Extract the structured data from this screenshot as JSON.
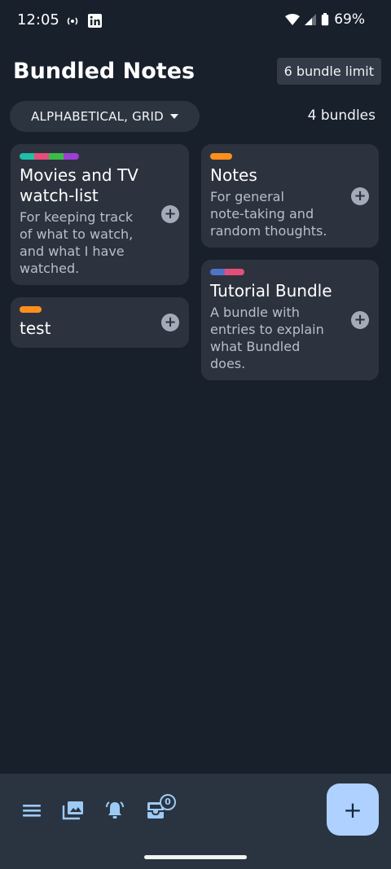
{
  "status": {
    "time": "12:05",
    "battery": "69%"
  },
  "header": {
    "title": "Bundled Notes",
    "limit_label": "6 bundle limit"
  },
  "toolbar": {
    "sort_label": "ALPHABETICAL, GRID",
    "count_label": "4 bundles"
  },
  "bundles": [
    {
      "title_line1": "Movies and TV",
      "title_line2": "watch-list",
      "desc": [
        "For keeping track",
        "of what to watch,",
        "and what I have",
        "watched."
      ],
      "colors": [
        "#1fbfa8",
        "#e44f7a",
        "#3dbb49",
        "#9b3fd6"
      ]
    },
    {
      "title": "test",
      "colors": [
        "#ff8f1c"
      ]
    },
    {
      "title": "Notes",
      "desc": [
        "For general",
        "note-taking and",
        "random thoughts."
      ],
      "colors": [
        "#ff8f1c"
      ]
    },
    {
      "title": "Tutorial Bundle",
      "desc": [
        "A bundle with",
        "entries to explain",
        "what Bundled",
        "does."
      ],
      "colors": [
        "#4f74c7",
        "#e44f7a"
      ]
    }
  ],
  "bottom_nav": {
    "inbox_badge": "0",
    "fab_label": "+"
  },
  "icons": {
    "add": "+"
  }
}
